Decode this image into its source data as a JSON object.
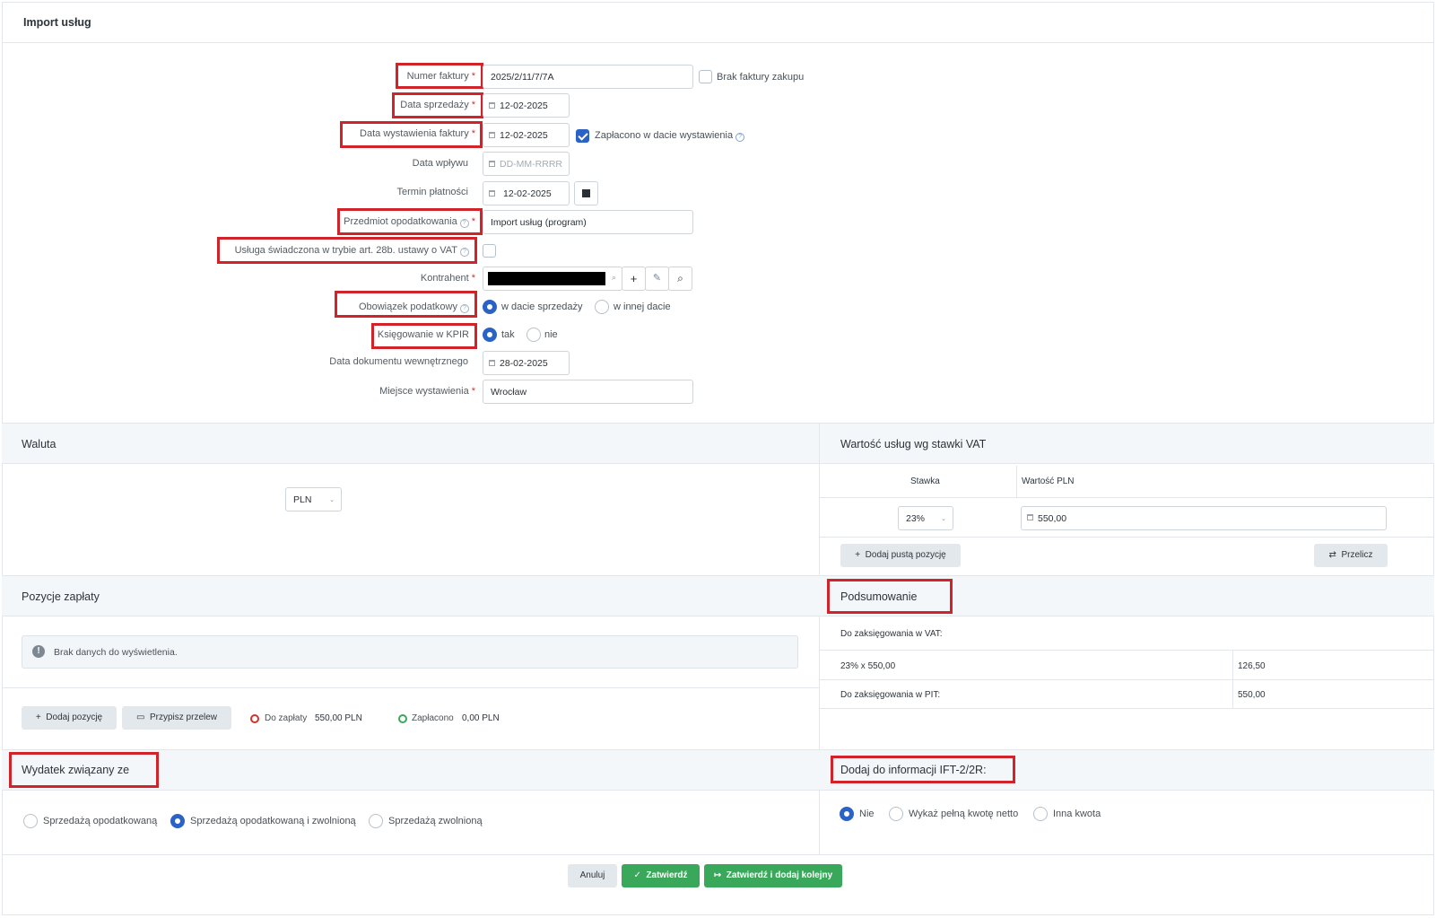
{
  "page": {
    "title": "Import usług"
  },
  "form": {
    "invoice_number": {
      "label": "Numer faktury",
      "value": "2025/2/11/7/7A"
    },
    "no_purchase_invoice": {
      "label": "Brak faktury zakupu",
      "checked": false
    },
    "sale_date": {
      "label": "Data sprzedaży",
      "value": "12-02-2025"
    },
    "issue_date": {
      "label": "Data wystawienia faktury",
      "value": "12-02-2025"
    },
    "paid_on_issue": {
      "label": "Zapłacono w dacie wystawienia",
      "checked": true
    },
    "receipt_date": {
      "label": "Data wpływu",
      "placeholder": "DD-MM-RRRR"
    },
    "payment_due": {
      "label": "Termin płatności",
      "value": "12-02-2025"
    },
    "tax_subject": {
      "label": "Przedmiot opodatkowania",
      "value": "Import usług (program)"
    },
    "art28b": {
      "label": "Usługa świadczona w trybie art. 28b. ustawy o VAT",
      "checked": false
    },
    "contractor": {
      "label": "Kontrahent",
      "value": ""
    },
    "tax_obligation": {
      "label": "Obowiązek podatkowy",
      "options": [
        "w dacie sprzedaży",
        "w innej dacie"
      ],
      "selected": "w dacie sprzedaży"
    },
    "kpir": {
      "label": "Księgowanie w KPIR",
      "options": [
        "tak",
        "nie"
      ],
      "selected": "tak"
    },
    "internal_doc_date": {
      "label": "Data dokumentu wewnętrznego",
      "value": "28-02-2025"
    },
    "issue_place": {
      "label": "Miejsce wystawienia",
      "value": "Wrocław"
    }
  },
  "currency": {
    "title": "Waluta",
    "value": "PLN"
  },
  "vat_values": {
    "title": "Wartość usług wg stawki VAT",
    "col_rate": "Stawka",
    "col_value": "Wartość PLN",
    "rows": [
      {
        "rate": "23%",
        "value": "550,00"
      }
    ],
    "add_empty": "Dodaj pustą pozycję",
    "recalc": "Przelicz"
  },
  "payments": {
    "title": "Pozycje zapłaty",
    "empty": "Brak danych do wyświetlenia.",
    "add": "Dodaj pozycję",
    "assign": "Przypisz przelew",
    "to_pay_label": "Do zapłaty",
    "to_pay_value": "550,00 PLN",
    "paid_label": "Zapłacono",
    "paid_value": "0,00 PLN"
  },
  "summary": {
    "title": "Podsumowanie",
    "vat_heading": "Do zaksięgowania w VAT:",
    "vat_row_label": "23% x 550,00",
    "vat_row_value": "126,50",
    "pit_label": "Do zaksięgowania w PIT:",
    "pit_value": "550,00"
  },
  "expense": {
    "title": "Wydatek związany ze",
    "options": [
      "Sprzedażą opodatkowaną",
      "Sprzedażą opodatkowaną i zwolnioną",
      "Sprzedażą zwolnioną"
    ],
    "selected": "Sprzedażą opodatkowaną i zwolnioną"
  },
  "ift": {
    "title": "Dodaj do informacji IFT-2/2R:",
    "options": [
      "Nie",
      "Wykaż pełną kwotę netto",
      "Inna kwota"
    ],
    "selected": "Nie"
  },
  "footer": {
    "cancel": "Anuluj",
    "confirm": "Zatwierdź",
    "confirm_add": "Zatwierdź i dodaj kolejny"
  },
  "colors": {
    "accent": "#2a62c6",
    "success": "#3aa85a",
    "danger": "#d0342c",
    "highlight": "#d0232a"
  }
}
